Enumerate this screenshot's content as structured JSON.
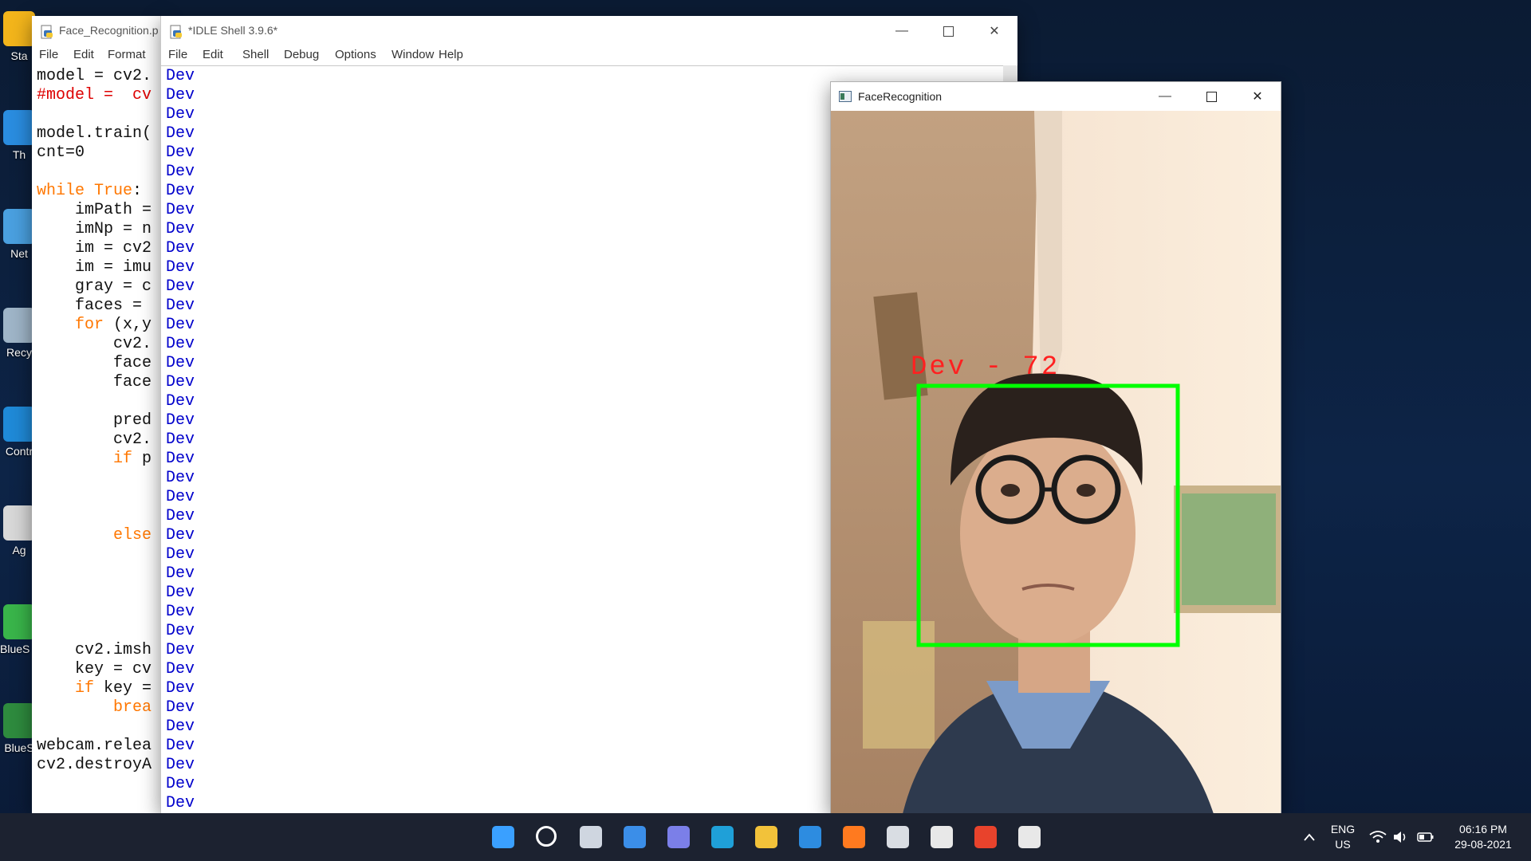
{
  "desktop": {
    "icons": [
      {
        "label": "Sta",
        "color": "#f3b51b"
      },
      {
        "label": "Th",
        "color": "#2a8de0"
      },
      {
        "label": "Net",
        "color": "#4aa0e0"
      },
      {
        "label": "Recy",
        "color": "#9fb5c8"
      },
      {
        "label": "Contr",
        "color": "#1f8ad8"
      },
      {
        "label": "Ag",
        "color": "#d8d8d8"
      },
      {
        "label": "BlueS Multi",
        "color": "#39b54a"
      },
      {
        "label": "BlueS",
        "color": "#2e8b3e"
      }
    ]
  },
  "editor": {
    "title": "Face_Recognition.p",
    "menu": [
      "File",
      "Edit",
      "Format"
    ],
    "code_lines": [
      {
        "t": "model = cv2.",
        "c": ""
      },
      {
        "t": "#model =  cv",
        "c": "cm"
      },
      {
        "t": "",
        "c": ""
      },
      {
        "t": "model.train(",
        "c": ""
      },
      {
        "t": "cnt=0",
        "c": ""
      },
      {
        "t": "",
        "c": ""
      },
      {
        "t": "while True:",
        "c": "kwline"
      },
      {
        "t": "    imPath =",
        "c": ""
      },
      {
        "t": "    imNp = n",
        "c": ""
      },
      {
        "t": "    im = cv2",
        "c": ""
      },
      {
        "t": "    im = imu",
        "c": ""
      },
      {
        "t": "    gray = c",
        "c": ""
      },
      {
        "t": "    faces =",
        "c": ""
      },
      {
        "t": "    for (x,y",
        "c": "for"
      },
      {
        "t": "        cv2.",
        "c": ""
      },
      {
        "t": "        face",
        "c": ""
      },
      {
        "t": "        face",
        "c": ""
      },
      {
        "t": "",
        "c": ""
      },
      {
        "t": "        pred",
        "c": ""
      },
      {
        "t": "        cv2.",
        "c": ""
      },
      {
        "t": "        if p",
        "c": "if"
      },
      {
        "t": "",
        "c": ""
      },
      {
        "t": "",
        "c": ""
      },
      {
        "t": "",
        "c": ""
      },
      {
        "t": "        else",
        "c": "else"
      },
      {
        "t": "",
        "c": ""
      },
      {
        "t": "",
        "c": ""
      },
      {
        "t": "",
        "c": ""
      },
      {
        "t": "",
        "c": ""
      },
      {
        "t": "",
        "c": ""
      },
      {
        "t": "    cv2.imsh",
        "c": ""
      },
      {
        "t": "    key = cv",
        "c": ""
      },
      {
        "t": "    if key =",
        "c": "if"
      },
      {
        "t": "        brea",
        "c": "brk"
      },
      {
        "t": "",
        "c": ""
      },
      {
        "t": "webcam.relea",
        "c": ""
      },
      {
        "t": "cv2.destroyA",
        "c": ""
      }
    ]
  },
  "shell": {
    "title": "*IDLE Shell 3.9.6*",
    "menu": [
      "File",
      "Edit",
      "Shell",
      "Debug",
      "Options",
      "Window",
      "Help"
    ],
    "output_line": "Dev",
    "output_count": 39
  },
  "facewin": {
    "title": "FaceRecognition",
    "label": "Dev - 72",
    "box_color": "#00ff00",
    "label_color": "#ff2020"
  },
  "taskbar": {
    "lang_top": "ENG",
    "lang_bottom": "US",
    "time": "06:16 PM",
    "date": "29-08-2021",
    "apps": [
      {
        "name": "start",
        "color": "#3aa0ff"
      },
      {
        "name": "search",
        "color": "#ffffff"
      },
      {
        "name": "task-view",
        "color": "#cfd6e0"
      },
      {
        "name": "widgets",
        "color": "#3b8ee8"
      },
      {
        "name": "chat",
        "color": "#7b7fe8"
      },
      {
        "name": "edge",
        "color": "#1fa0d8"
      },
      {
        "name": "file-explorer",
        "color": "#f2c23a"
      },
      {
        "name": "mail",
        "color": "#2d8ce0"
      },
      {
        "name": "firefox",
        "color": "#ff7a1f"
      },
      {
        "name": "amazon",
        "color": "#d9dde3"
      },
      {
        "name": "store",
        "color": "#e8e8e8"
      },
      {
        "name": "office",
        "color": "#e8432c"
      },
      {
        "name": "idle",
        "color": "#e8e8e8"
      }
    ]
  }
}
